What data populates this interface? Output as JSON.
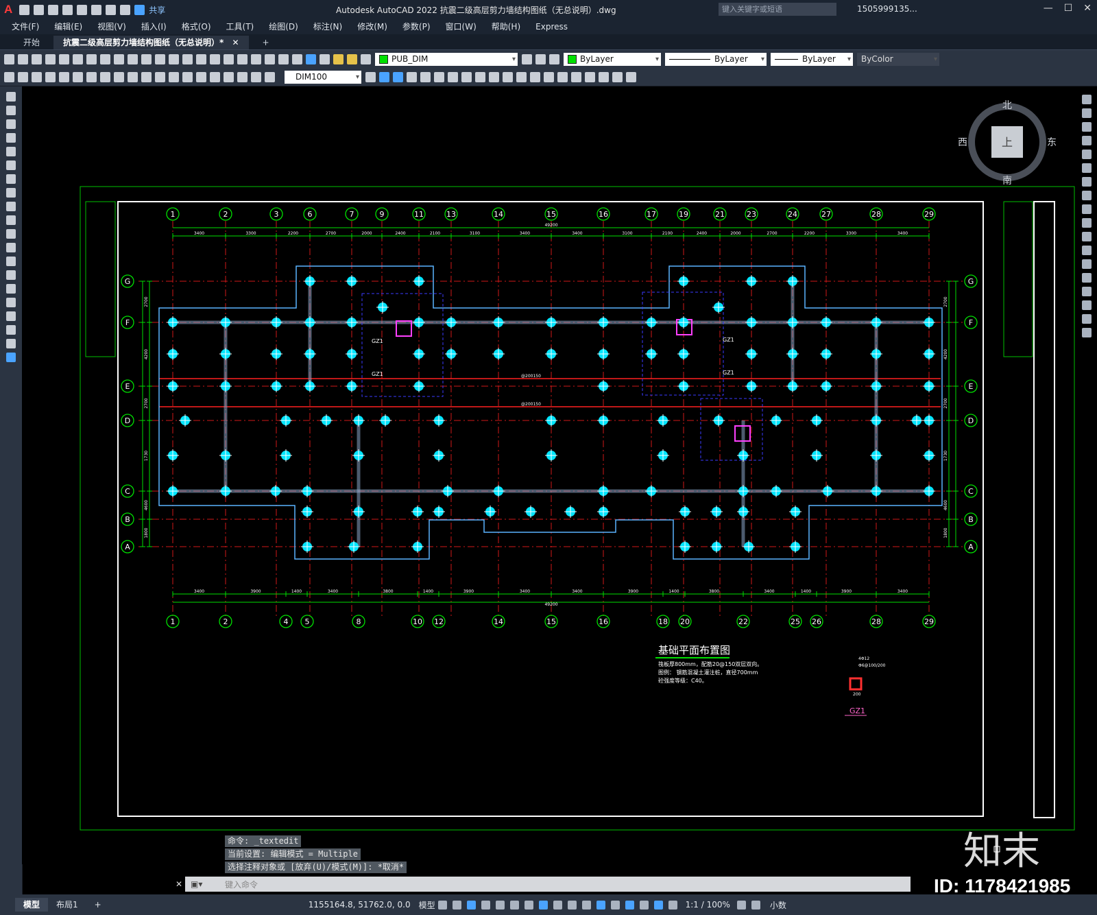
{
  "app": {
    "logo": "A",
    "title": "Autodesk AutoCAD 2022    抗震二级高层剪力墙结构图纸（无总说明）.dwg",
    "share_label": "共享",
    "search_placeholder": "键入关键字或短语",
    "user": "1505999135...",
    "window_controls": [
      "—",
      "☐",
      "✕"
    ]
  },
  "menu": [
    "文件(F)",
    "编辑(E)",
    "视图(V)",
    "插入(I)",
    "格式(O)",
    "工具(T)",
    "绘图(D)",
    "标注(N)",
    "修改(M)",
    "参数(P)",
    "窗口(W)",
    "帮助(H)",
    "Express"
  ],
  "tabs": [
    {
      "label": "开始",
      "active": false
    },
    {
      "label": "抗震二级高层剪力墙结构图纸（无总说明）*",
      "active": true
    }
  ],
  "toolbar": {
    "layer": "PUB_DIM",
    "color": "ByLayer",
    "linetype": "ByLayer",
    "lineweight": "ByLayer",
    "plotstyle": "ByColor",
    "dimstyle": "DIM100"
  },
  "compass": {
    "north": "北",
    "south": "南",
    "east": "东",
    "west": "西",
    "center": "上"
  },
  "drawing": {
    "top_axes": [
      "1",
      "2",
      "3",
      "6",
      "7",
      "9",
      "11",
      "13",
      "14",
      "15",
      "16",
      "17",
      "19",
      "21",
      "23",
      "24",
      "27",
      "28",
      "29"
    ],
    "bottom_axes": [
      "1",
      "2",
      "4",
      "5",
      "8",
      "10",
      "12",
      "14",
      "15",
      "16",
      "18",
      "20",
      "22",
      "25",
      "26",
      "28",
      "29"
    ],
    "row_axes": [
      "G",
      "F",
      "E",
      "D",
      "C",
      "B",
      "A"
    ],
    "top_dims": [
      "3400",
      "3300",
      "2200",
      "2700",
      "2000",
      "2400",
      "2100",
      "3100",
      "3400",
      "3400",
      "3100",
      "2100",
      "2400",
      "2000",
      "2700",
      "2200",
      "3300",
      "3400"
    ],
    "bottom_dims": [
      "3400",
      "3900",
      "1400",
      "3400",
      "3800",
      "1400",
      "3900",
      "3400",
      "3400",
      "3900",
      "1400",
      "3800",
      "3400",
      "1400",
      "3900",
      "3400"
    ],
    "overall_dim": "49200",
    "left_dims": [
      "2700",
      "4200",
      "2700",
      "1730",
      "4600",
      "1800",
      "1800"
    ],
    "callouts": [
      "@200150",
      "@200150",
      "GZ1",
      "GZ1",
      "GZ1",
      "GZ1"
    ],
    "plan_title": "基础平面布置图",
    "notes": [
      "筏板厚800mm，配筋20@150双层双向。",
      "图例：  钢筋混凝土灌注桩，直径700mm",
      "砼强度等级：C40。"
    ],
    "detail_label": "GZ1",
    "detail_rebar": "4Φ12",
    "detail_stirrup": "Φ6@100/200",
    "detail_size": "200"
  },
  "command": {
    "history": [
      "命令: _textedit",
      "当前设置: 编辑模式 = Multiple",
      "选择注释对象或 [放弃(U)/模式(M)]: *取消*"
    ],
    "input_placeholder": "键入命令"
  },
  "status": {
    "layouts": [
      "模型",
      "布局1"
    ],
    "coords": "1155164.8, 51762.0, 0.0",
    "mode": "模型",
    "scale": "1:1 / 100%",
    "units": "小数"
  },
  "watermark": {
    "brand": "知末",
    "id": "ID: 1178421985"
  }
}
